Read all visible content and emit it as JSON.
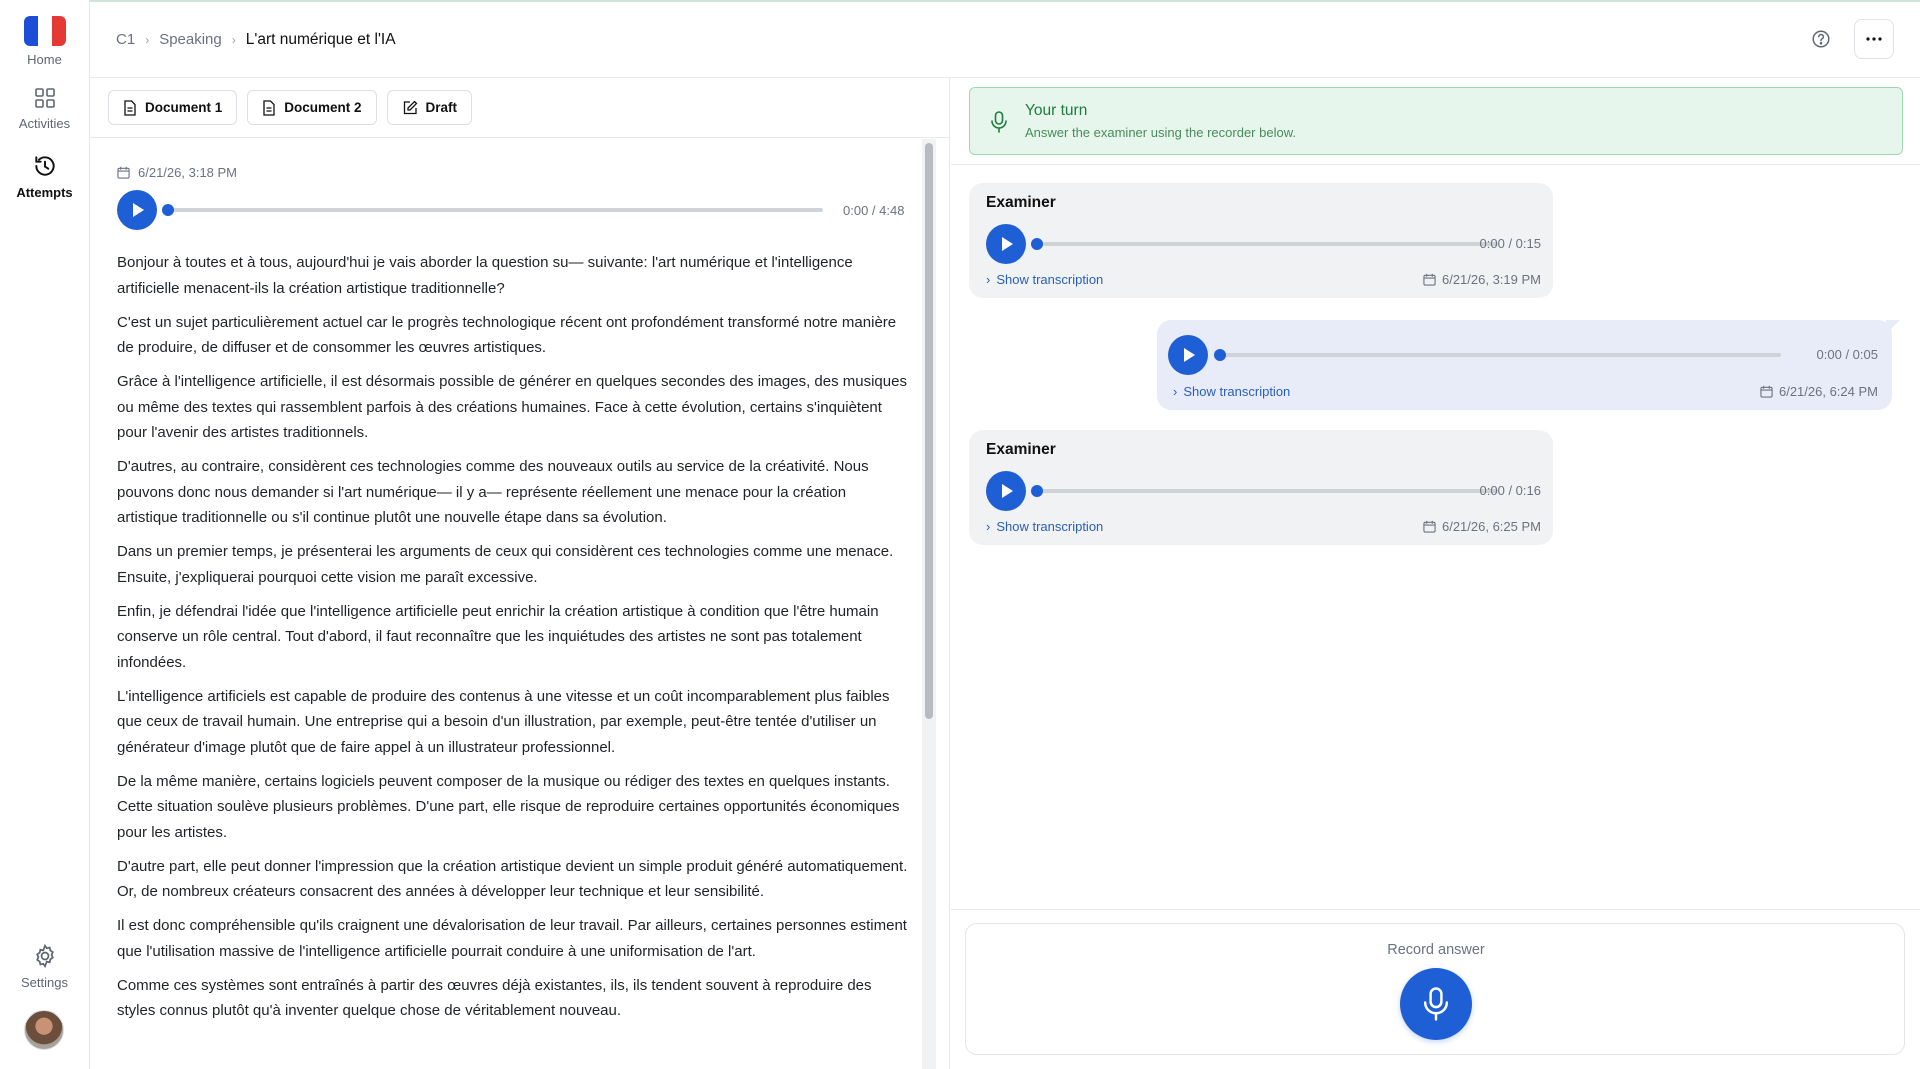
{
  "sidebar": {
    "items": [
      {
        "label": "Home",
        "icon": "french-flag-icon"
      },
      {
        "label": "Activities",
        "icon": "grid-icon"
      },
      {
        "label": "Attempts",
        "icon": "history-icon"
      },
      {
        "label": "Settings",
        "icon": "gear-icon"
      }
    ],
    "flag_colors": [
      "#1d4ed8",
      "#ffffff",
      "#e53935"
    ]
  },
  "breadcrumb": [
    "C1",
    "Speaking",
    "L'art numérique et l'IA"
  ],
  "doc_tabs": [
    {
      "label": "Document 1",
      "icon": "document-icon"
    },
    {
      "label": "Document 2",
      "icon": "document-icon"
    },
    {
      "label": "Draft",
      "icon": "edit-icon"
    }
  ],
  "recording": {
    "date": "6/21/26, 3:18 PM",
    "time": "0:00 / 4:48",
    "progress": 0
  },
  "transcript": [
    "Bonjour à toutes et à tous, aujourd'hui je vais aborder la question su— suivante: l'art numérique et l'intelligence artificielle menacent-ils la création artistique traditionnelle?",
    "C'est un sujet particulièrement actuel car le progrès technologique récent ont profondément transformé notre manière de produire, de diffuser et de consommer les œuvres artistiques.",
    "Grâce à l'intelligence artificielle, il est désormais possible de générer en quelques secondes des images, des musiques ou même des textes qui rassemblent parfois à des créations humaines. Face à cette évolution, certains s'inquiètent pour l'avenir des artistes traditionnels.",
    "D'autres, au contraire, considèrent ces technologies comme des nouveaux outils au service de la créativité. Nous pouvons donc nous demander si l'art numérique— il y a— représente réellement une menace pour la création artistique traditionnelle ou s'il continue plutôt une nouvelle étape dans sa évolution.",
    "Dans un premier temps, je présenterai les arguments de ceux qui considèrent ces technologies comme une menace. Ensuite, j'expliquerai pourquoi cette vision me paraît excessive.",
    "Enfin, je défendrai l'idée que l'intelligence artificielle peut enrichir la création artistique à condition que l'être humain conserve un rôle central. Tout d'abord, il faut reconnaître que les inquiétudes des artistes ne sont pas totalement infondées.",
    "L'intelligence artificiels est capable de produire des contenus à une vitesse et un coût incomparablement plus faibles que ceux de travail humain. Une entreprise qui a besoin d'un illustration, par exemple, peut-être tentée d'utiliser un générateur d'image plutôt que de faire appel à un illustrateur professionnel.",
    "De la même manière, certains logiciels peuvent composer de la musique ou rédiger des textes en quelques instants. Cette situation soulève plusieurs problèmes. D'une part, elle risque de reproduire certaines opportunités économiques pour les artistes.",
    "D'autre part, elle peut donner l'impression que la création artistique devient un simple produit généré automatiquement. Or, de nombreux créateurs consacrent des années à développer leur technique et leur sensibilité.",
    "Il est donc compréhensible qu'ils craignent une dévalorisation de leur travail. Par ailleurs, certaines personnes estiment que l'utilisation massive de l'intelligence artificielle pourrait conduire à une uniformisation de l'art.",
    "Comme ces systèmes sont entraînés à partir des œuvres déjà existantes, ils, ils tendent souvent à reproduire des styles connus plutôt qu'à inventer quelque chose de véritablement nouveau."
  ],
  "your_turn": {
    "title": "Your turn",
    "subtitle": "Answer the examiner using the recorder below."
  },
  "messages": [
    {
      "sender": "Examiner",
      "time": "0:00 / 0:15",
      "show_label": "Show transcription",
      "date": "6/21/26, 3:19 PM"
    },
    {
      "sender": "",
      "time": "0:00 / 0:05",
      "show_label": "Show transcription",
      "date": "6/21/26, 6:24 PM"
    },
    {
      "sender": "Examiner",
      "time": "0:00 / 0:16",
      "show_label": "Show transcription",
      "date": "6/21/26, 6:25 PM"
    }
  ],
  "recorder": {
    "label": "Record answer"
  },
  "colors": {
    "accent": "#1f5fd6",
    "success_bg": "#e7f6ec",
    "success_text": "#1e7d3c",
    "user_bubble": "#e8ecf8",
    "examiner_bubble": "#f1f2f4"
  }
}
